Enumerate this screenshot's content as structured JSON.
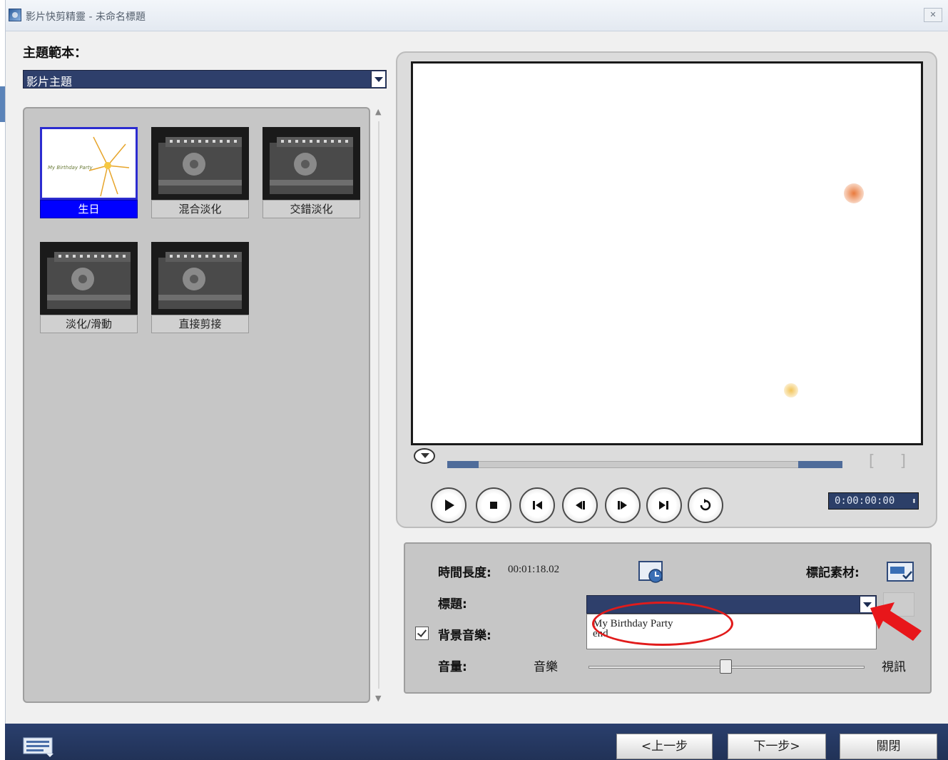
{
  "window": {
    "title": "影片快剪精靈 - 未命名標題",
    "close_label": "✕"
  },
  "template": {
    "label": "主題範本：",
    "category": "影片主題",
    "items": [
      {
        "label": "生日",
        "selected": true,
        "thumb_text": "My Birthday Party"
      },
      {
        "label": "混合淡化",
        "selected": false
      },
      {
        "label": "交錯淡化",
        "selected": false
      },
      {
        "label": "淡化/滑動",
        "selected": false
      },
      {
        "label": "直接剪接",
        "selected": false
      }
    ]
  },
  "preview": {
    "timecode": "0:00:00:00",
    "bracket_label": "[ ]",
    "controls": [
      "play-icon",
      "stop-icon",
      "go-to-start-icon",
      "previous-frame-icon",
      "next-frame-icon",
      "go-to-end-icon",
      "repeat-icon"
    ]
  },
  "properties": {
    "duration_label": "時間長度:",
    "duration_value": "00:01:18.02",
    "mark_clips_label": "標記素材:",
    "title_label": "標題:",
    "title_selected": "",
    "title_options": [
      "My Birthday Party",
      "end"
    ],
    "bg_music_label": "背景音樂:",
    "bg_music_checked": true,
    "volume_label": "音量:",
    "volume_left": "音樂",
    "volume_right": "視訊",
    "volume_balance": 0.5
  },
  "footer": {
    "back_label": "<上一步",
    "next_label": "下一步>",
    "close_label": "關閉"
  },
  "colors": {
    "accent": "#2e3f6b",
    "selection": "#0000ff",
    "annotation": "#e11b1b"
  }
}
